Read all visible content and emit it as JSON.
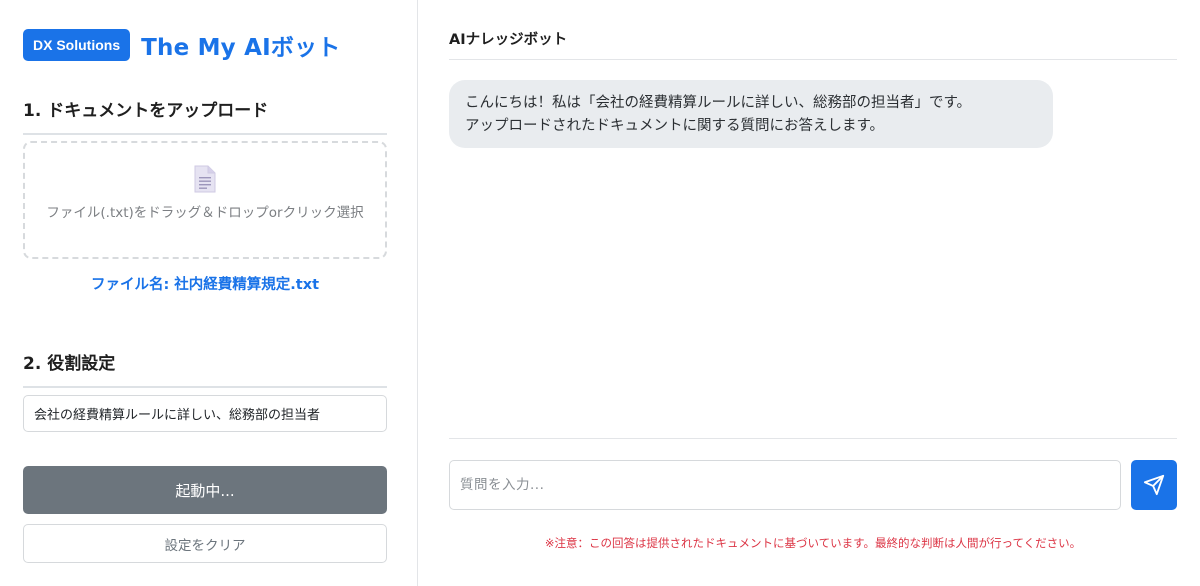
{
  "brand": {
    "badge": "DX Solutions",
    "title": "The My AIボット"
  },
  "sidebar": {
    "upload_heading": "1. ドキュメントをアップロード",
    "dropzone_text": "ファイル(.txt)をドラッグ＆ドロップorクリック選択",
    "file_name": "ファイル名: 社内経費精算規定.txt",
    "role_heading": "2. 役割設定",
    "role_value": "会社の経費精算ルールに詳しい、総務部の担当者",
    "start_button": "起動中...",
    "clear_button": "設定をクリア"
  },
  "chat": {
    "header": "AIナレッジボット",
    "messages": [
      {
        "role": "bot",
        "line1": "こんにちは！私は「会社の経費精算ルールに詳しい、総務部の担当者」です。",
        "line2": "アップロードされたドキュメントに関する質問にお答えします。"
      }
    ],
    "input_placeholder": "質問を入力...",
    "notice": "※注意：この回答は提供されたドキュメントに基づいています。最終的な判断は人間が行ってください。"
  },
  "colors": {
    "accent": "#1a73e8",
    "button_disabled": "#6c757d",
    "bubble_bg": "#e9ecef",
    "notice": "#dc3545"
  },
  "icons": {
    "dropzone": "document-icon",
    "send": "paper-plane-icon"
  }
}
